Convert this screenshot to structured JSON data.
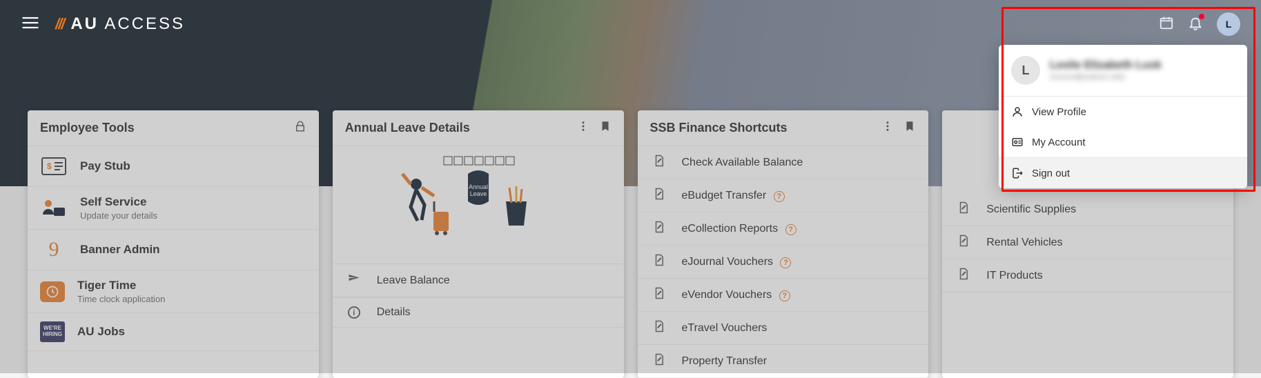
{
  "brand": {
    "slashes": "///",
    "bold": "AU",
    "light": "ACCESS"
  },
  "avatar_initial": "L",
  "cards": {
    "employee": {
      "title": "Employee Tools",
      "items": [
        {
          "title": "Pay Stub",
          "sub": ""
        },
        {
          "title": "Self Service",
          "sub": "Update your details"
        },
        {
          "title": "Banner Admin",
          "sub": ""
        },
        {
          "title": "Tiger Time",
          "sub": "Time clock application"
        },
        {
          "title": "AU Jobs",
          "sub": ""
        }
      ]
    },
    "annual": {
      "title": "Annual Leave Details",
      "badge_text": "Annual\nLeave",
      "items": [
        {
          "label": "Leave Balance"
        },
        {
          "label": "Details"
        }
      ]
    },
    "finance": {
      "title": "SSB Finance Shortcuts",
      "items": [
        {
          "label": "Check Available Balance",
          "help": false
        },
        {
          "label": "eBudget Transfer",
          "help": true
        },
        {
          "label": "eCollection Reports",
          "help": true
        },
        {
          "label": "eJournal Vouchers",
          "help": true
        },
        {
          "label": "eVendor Vouchers",
          "help": true
        },
        {
          "label": "eTravel Vouchers",
          "help": false
        },
        {
          "label": "Property Transfer",
          "help": false
        }
      ]
    },
    "tigerbuy": {
      "title_hidden": "",
      "items": [
        {
          "label": "Scientific Supplies"
        },
        {
          "label": "Rental Vehicles"
        },
        {
          "label": "IT Products"
        }
      ]
    }
  },
  "profile_menu": {
    "initial": "L",
    "name": "Leslie Elizabeth Lusk",
    "email": "xxxxxx@auburn.edu",
    "items": {
      "view_profile": "View Profile",
      "my_account": "My Account",
      "sign_out": "Sign out"
    }
  }
}
